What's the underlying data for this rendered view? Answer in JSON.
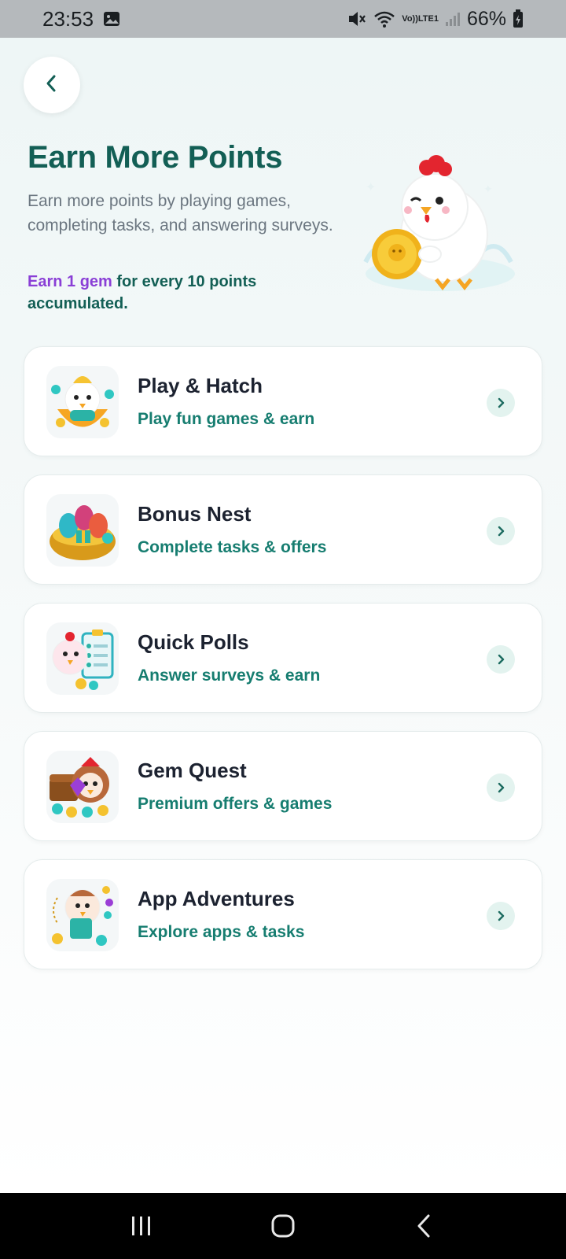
{
  "status_bar": {
    "time": "23:53",
    "volte": "Vo))",
    "lte": "LTE1",
    "battery": "66%"
  },
  "header": {
    "back_icon": "chevron-left-icon",
    "title": "Earn More Points",
    "subtitle": "Earn more points by playing games, completing tasks, and answering surveys.",
    "gem_note_accent": "Earn 1 gem",
    "gem_note_rest": " for every 10 points accumulated."
  },
  "options": [
    {
      "title": "Play & Hatch",
      "subtitle": "Play fun games & earn",
      "icon": "egg-chick-icon"
    },
    {
      "title": "Bonus Nest",
      "subtitle": "Complete tasks & offers",
      "icon": "egg-nest-icon"
    },
    {
      "title": "Quick Polls",
      "subtitle": "Answer surveys & earn",
      "icon": "chick-clipboard-icon"
    },
    {
      "title": "Gem Quest",
      "subtitle": "Premium offers & games",
      "icon": "treasure-chick-icon"
    },
    {
      "title": "App Adventures",
      "subtitle": "Explore apps & tasks",
      "icon": "chick-tablet-icon"
    }
  ],
  "colors": {
    "brand_green": "#135f55",
    "accent_teal": "#167d70",
    "accent_purple": "#8a3fd6"
  }
}
